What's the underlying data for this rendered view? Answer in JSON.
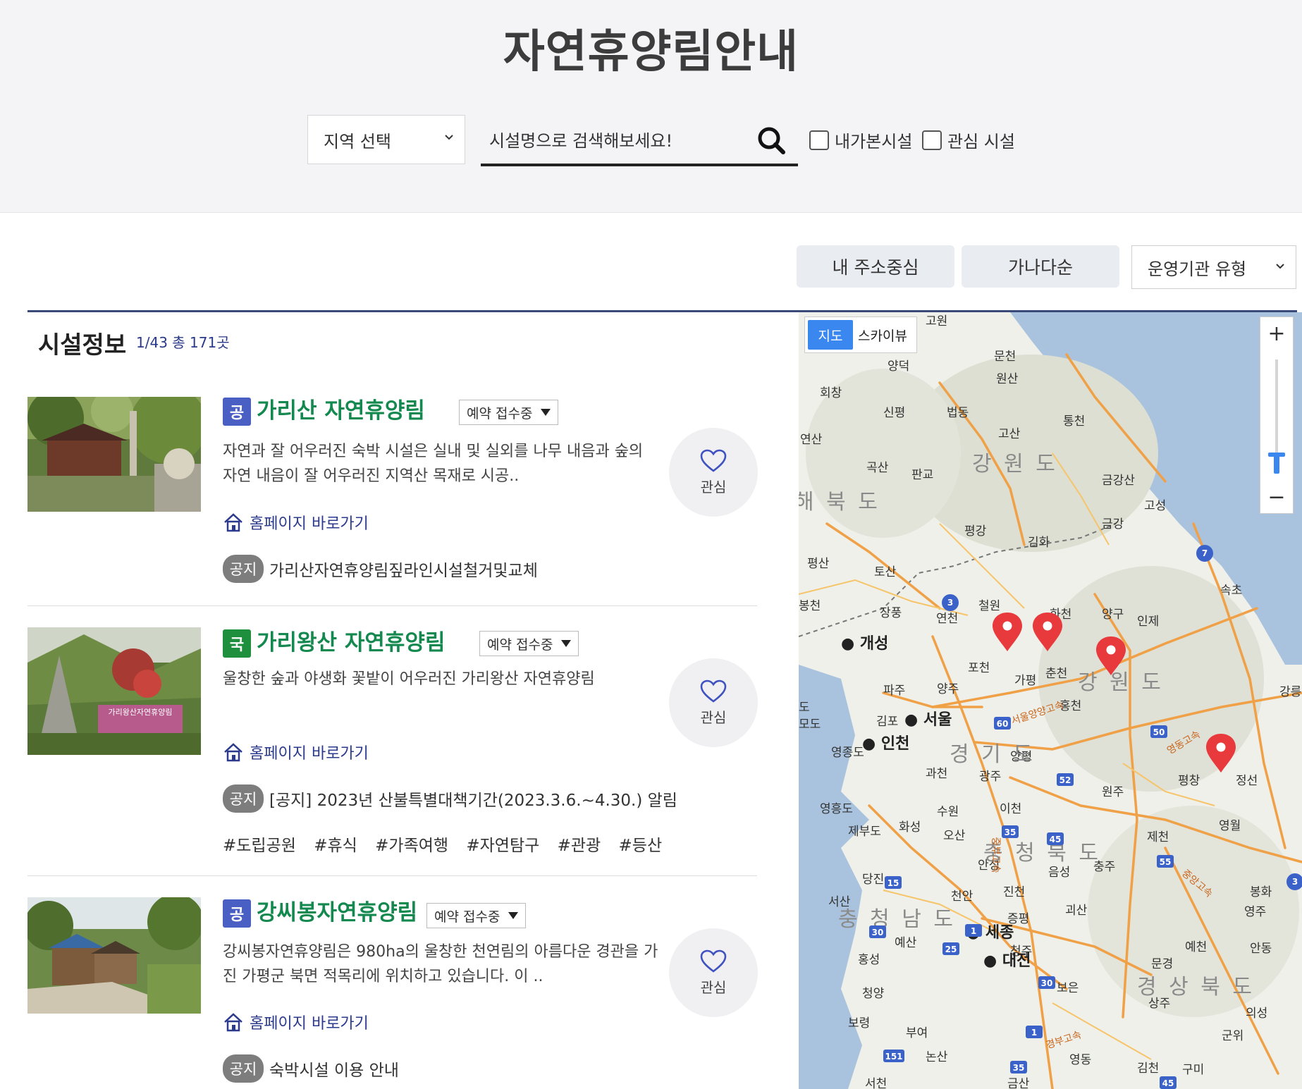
{
  "header": {
    "title": "자연휴양림안내",
    "region_select": "지역 선택",
    "search_placeholder": "시설명으로 검색해보세요!",
    "check_visited": "내가본시설",
    "check_interest": "관심 시설"
  },
  "sort": {
    "address_btn": "내 주소중심",
    "alpha_btn": "가나다순",
    "org_select": "운영기관 유형"
  },
  "section": {
    "title": "시설정보",
    "meta": "1/43 총 171곳"
  },
  "facilities": [
    {
      "badge": "공",
      "badge_color": "#4a5fc4",
      "name": "가리산 자연휴양림",
      "status": "예약 접수중",
      "desc": " 자연과 잘 어우러진 숙박 시설은 실내 및 실외를 나무 내음과 숲의 자연 내음이 잘 어우러진 지역산 목재로 시공..",
      "home_link": "홈페이지 바로가기",
      "notice_tag": "공지",
      "notice": "가리산자연휴양림짚라인시설철거및교체",
      "like": "관심"
    },
    {
      "badge": "국",
      "badge_color": "#1e8f3c",
      "name": "가리왕산 자연휴양림",
      "status": "예약 접수중",
      "desc": "울창한 숲과 야생화 꽃밭이 어우러진 가리왕산 자연휴양림",
      "home_link": "홈페이지 바로가기",
      "notice_tag": "공지",
      "notice": "[공지] 2023년 산불특별대책기간(2023.3.6.~4.30.) 알림",
      "tags": [
        "#도립공원",
        "#휴식",
        "#가족여행",
        "#자연탐구",
        "#관광",
        "#등산"
      ],
      "like": "관심",
      "thumb_sign": "가리왕산자연휴양림"
    },
    {
      "badge": "공",
      "badge_color": "#4a5fc4",
      "name": "강씨봉자연휴양림",
      "status": "예약 접수중",
      "desc": "강씨봉자연휴양림은 980ha의 울창한 천연림의 아름다운 경관을 가진 가평군 북면 적목리에 위치하고 있습니다. 이 ..",
      "home_link": "홈페이지 바로가기",
      "notice_tag": "공지",
      "notice": "숙박시설 이용 안내",
      "like": "관심"
    }
  ],
  "map": {
    "tab_map": "지도",
    "tab_sky": "스카이뷰",
    "zoom_in": "+",
    "zoom_out": "−",
    "accent": "#3a87f0",
    "pin_color": "#e8393c",
    "labels": [
      {
        "t": "고원"
      },
      {
        "t": "양덕"
      },
      {
        "t": "문천"
      },
      {
        "t": "원산"
      },
      {
        "t": "회창"
      },
      {
        "t": "신평"
      },
      {
        "t": "법동"
      },
      {
        "t": "통천"
      },
      {
        "t": "고산"
      },
      {
        "t": "연산"
      },
      {
        "t": "곡산"
      },
      {
        "t": "판교"
      },
      {
        "t": "금강산"
      },
      {
        "t": "고성"
      },
      {
        "t": "금강"
      },
      {
        "t": "평강"
      },
      {
        "t": "김화"
      },
      {
        "t": "평산"
      },
      {
        "t": "토산"
      },
      {
        "t": "속초"
      },
      {
        "t": "봉천"
      },
      {
        "t": "장풍"
      },
      {
        "t": "연천"
      },
      {
        "t": "철원"
      },
      {
        "t": "화천"
      },
      {
        "t": "양구"
      },
      {
        "t": "인제"
      },
      {
        "t": "포천"
      },
      {
        "t": "가평"
      },
      {
        "t": "춘천"
      },
      {
        "t": "파주"
      },
      {
        "t": "양주"
      },
      {
        "t": "홍천"
      },
      {
        "t": "강릉"
      },
      {
        "t": "김포"
      },
      {
        "t": "영종도"
      },
      {
        "t": "과천"
      },
      {
        "t": "양평"
      },
      {
        "t": "광주"
      },
      {
        "t": "원주"
      },
      {
        "t": "평창"
      },
      {
        "t": "정선"
      },
      {
        "t": "영흥도"
      },
      {
        "t": "제부도"
      },
      {
        "t": "화성"
      },
      {
        "t": "수원"
      },
      {
        "t": "이천"
      },
      {
        "t": "오산"
      },
      {
        "t": "영월"
      },
      {
        "t": "제천"
      },
      {
        "t": "안성"
      },
      {
        "t": "음성"
      },
      {
        "t": "충주"
      },
      {
        "t": "진천"
      },
      {
        "t": "당진"
      },
      {
        "t": "서산"
      },
      {
        "t": "천안"
      },
      {
        "t": "증평"
      },
      {
        "t": "괴산"
      },
      {
        "t": "봉화"
      },
      {
        "t": "영주"
      },
      {
        "t": "예산"
      },
      {
        "t": "홍성"
      },
      {
        "t": "청주"
      },
      {
        "t": "문경"
      },
      {
        "t": "예천"
      },
      {
        "t": "안동"
      },
      {
        "t": "청양"
      },
      {
        "t": "보은"
      },
      {
        "t": "상주"
      },
      {
        "t": "의성"
      },
      {
        "t": "보령"
      },
      {
        "t": "부여"
      },
      {
        "t": "군위"
      },
      {
        "t": "논산"
      },
      {
        "t": "영동"
      },
      {
        "t": "김천"
      },
      {
        "t": "구미"
      },
      {
        "t": "서천"
      },
      {
        "t": "금산"
      },
      {
        "t": "모도"
      },
      {
        "t": "도"
      }
    ],
    "cities": [
      {
        "t": "개성"
      },
      {
        "t": "서울"
      },
      {
        "t": "인천"
      },
      {
        "t": "세종"
      },
      {
        "t": "대전"
      }
    ],
    "provinces": [
      {
        "t": "강 원 도"
      },
      {
        "t": "강 원 도"
      },
      {
        "t": "경 기 도"
      },
      {
        "t": "충 청 북 도"
      },
      {
        "t": "충 청 남 도"
      },
      {
        "t": "경 상 북 도"
      },
      {
        "t": "해 북 도"
      }
    ],
    "road_labels": [
      {
        "t": "서울양양고속"
      },
      {
        "t": "영동고속"
      },
      {
        "t": "경부고속"
      },
      {
        "t": "중앙고속"
      },
      {
        "t": "중부고속"
      }
    ],
    "shields": [
      {
        "t": "3"
      },
      {
        "t": "7"
      },
      {
        "t": "60"
      },
      {
        "t": "50"
      },
      {
        "t": "52"
      },
      {
        "t": "35"
      },
      {
        "t": "45"
      },
      {
        "t": "55"
      },
      {
        "t": "15"
      },
      {
        "t": "30"
      },
      {
        "t": "1"
      },
      {
        "t": "25"
      },
      {
        "t": "30"
      },
      {
        "t": "1"
      },
      {
        "t": "151"
      },
      {
        "t": "35"
      },
      {
        "t": "45"
      },
      {
        "t": "3"
      }
    ]
  }
}
